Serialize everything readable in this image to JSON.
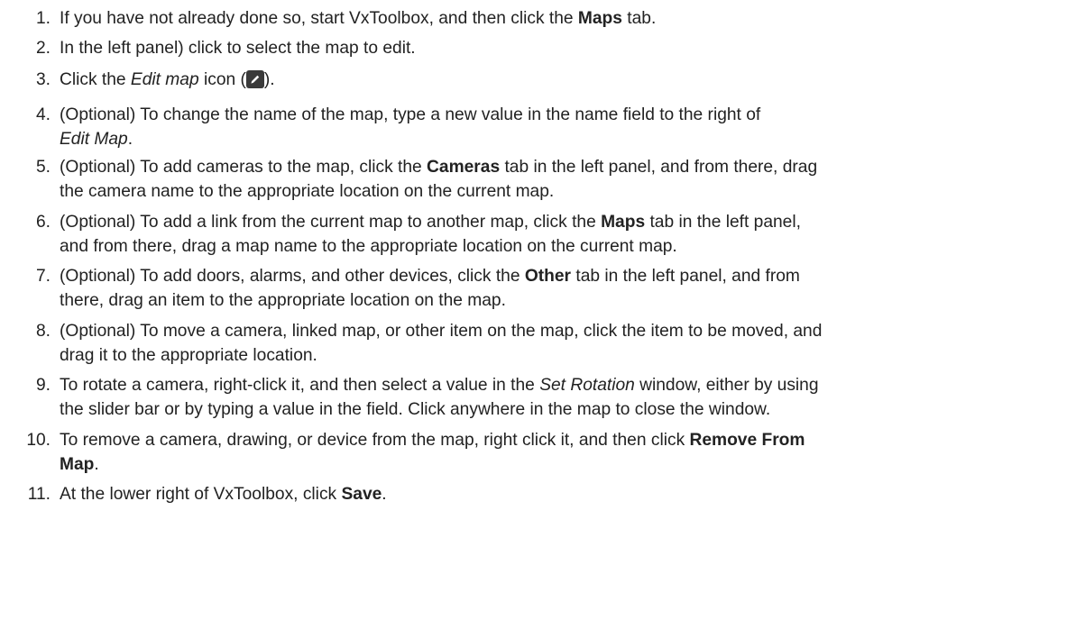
{
  "steps": [
    {
      "num": "1.",
      "parts": [
        {
          "t": "If you have not already done so, start VxToolbox, and then click the "
        },
        {
          "t": "Maps",
          "b": true
        },
        {
          "t": " tab."
        }
      ]
    },
    {
      "num": "2.",
      "parts": [
        {
          "t": "In the left panel) click to select the map to edit."
        }
      ]
    },
    {
      "num": "3.",
      "parts": [
        {
          "t": "Click the "
        },
        {
          "t": "Edit map",
          "i": true
        },
        {
          "t": " icon ("
        },
        {
          "icon": "edit-map-icon"
        },
        {
          "t": ")."
        }
      ]
    },
    {
      "num": "4.",
      "parts": [
        {
          "t": "(Optional) To change the name of the map, type a new value in the name field to the right of"
        },
        {
          "br": true
        },
        {
          "t": "Edit Map",
          "i": true
        },
        {
          "t": "."
        }
      ]
    },
    {
      "num": "5.",
      "parts": [
        {
          "t": "(Optional) To add cameras to the map, click the "
        },
        {
          "t": "Cameras",
          "b": true
        },
        {
          "t": " tab in the left panel, and from there, drag"
        },
        {
          "br": true
        },
        {
          "t": "the camera name to the appropriate location on the current map."
        }
      ]
    },
    {
      "num": "6.",
      "parts": [
        {
          "t": "(Optional) To add a link from the current map to another map, click the "
        },
        {
          "t": "Maps",
          "b": true
        },
        {
          "t": " tab in the left panel,"
        },
        {
          "br": true
        },
        {
          "t": "and from there, drag a map name to the appropriate location on the current map."
        }
      ]
    },
    {
      "num": "7.",
      "parts": [
        {
          "t": "(Optional) To add doors, alarms, and other devices, click the "
        },
        {
          "t": "Other",
          "b": true
        },
        {
          "t": " tab in the left panel, and from"
        },
        {
          "br": true
        },
        {
          "t": "there, drag an item to the appropriate location on the map."
        }
      ]
    },
    {
      "num": "8.",
      "parts": [
        {
          "t": "(Optional) To move a camera, linked map, or other item on the map, click the item to be moved, and"
        },
        {
          "br": true
        },
        {
          "t": "drag it to the appropriate location."
        }
      ]
    },
    {
      "num": "9.",
      "parts": [
        {
          "t": "To rotate a camera, right-click it, and then select a value in the "
        },
        {
          "t": "Set Rotation",
          "i": true
        },
        {
          "t": " window, either by using"
        },
        {
          "br": true
        },
        {
          "t": "the slider bar or by typing a value in the field. Click anywhere in the map to close the window."
        }
      ]
    },
    {
      "num": "10.",
      "parts": [
        {
          "t": "To remove a camera, drawing, or device from the map, right click it, and then click "
        },
        {
          "t": "Remove From",
          "b": true
        },
        {
          "br": true
        },
        {
          "t": "Map",
          "b": true
        },
        {
          "t": "."
        }
      ]
    },
    {
      "num": "11.",
      "parts": [
        {
          "t": "At the lower right of VxToolbox, click "
        },
        {
          "t": "Save",
          "b": true
        },
        {
          "t": "."
        }
      ]
    }
  ]
}
